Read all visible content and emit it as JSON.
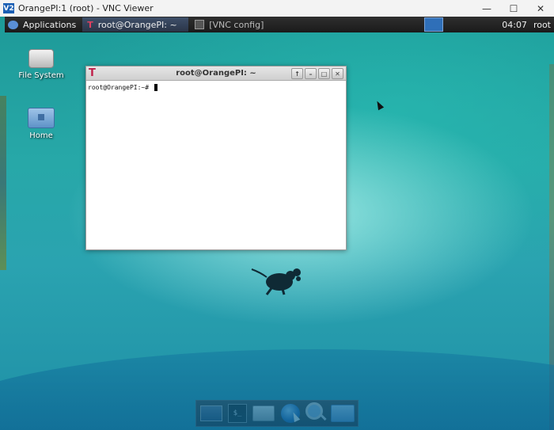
{
  "viewer": {
    "logo": "V2",
    "title": "OrangePI:1 (root) - VNC Viewer",
    "minimize": "—",
    "maximize": "☐",
    "close": "✕"
  },
  "panel": {
    "applications_label": "Applications",
    "tasks": [
      {
        "label": "root@OrangePI: ~",
        "active": true
      },
      {
        "label": "[VNC config]",
        "active": false
      }
    ],
    "clock": "04:07",
    "user": "root"
  },
  "desktop_icons": [
    {
      "label": "File System",
      "icon": "drive-icon"
    },
    {
      "label": "Home",
      "icon": "home-folder-icon"
    }
  ],
  "terminal": {
    "title": "root@OrangePI: ~",
    "prompt": "root@OrangePI:~# "
  },
  "dock": {
    "items": [
      "show-desktop-icon",
      "terminal-icon",
      "home-folder-icon",
      "web-browser-icon",
      "search-icon",
      "file-manager-icon"
    ]
  }
}
